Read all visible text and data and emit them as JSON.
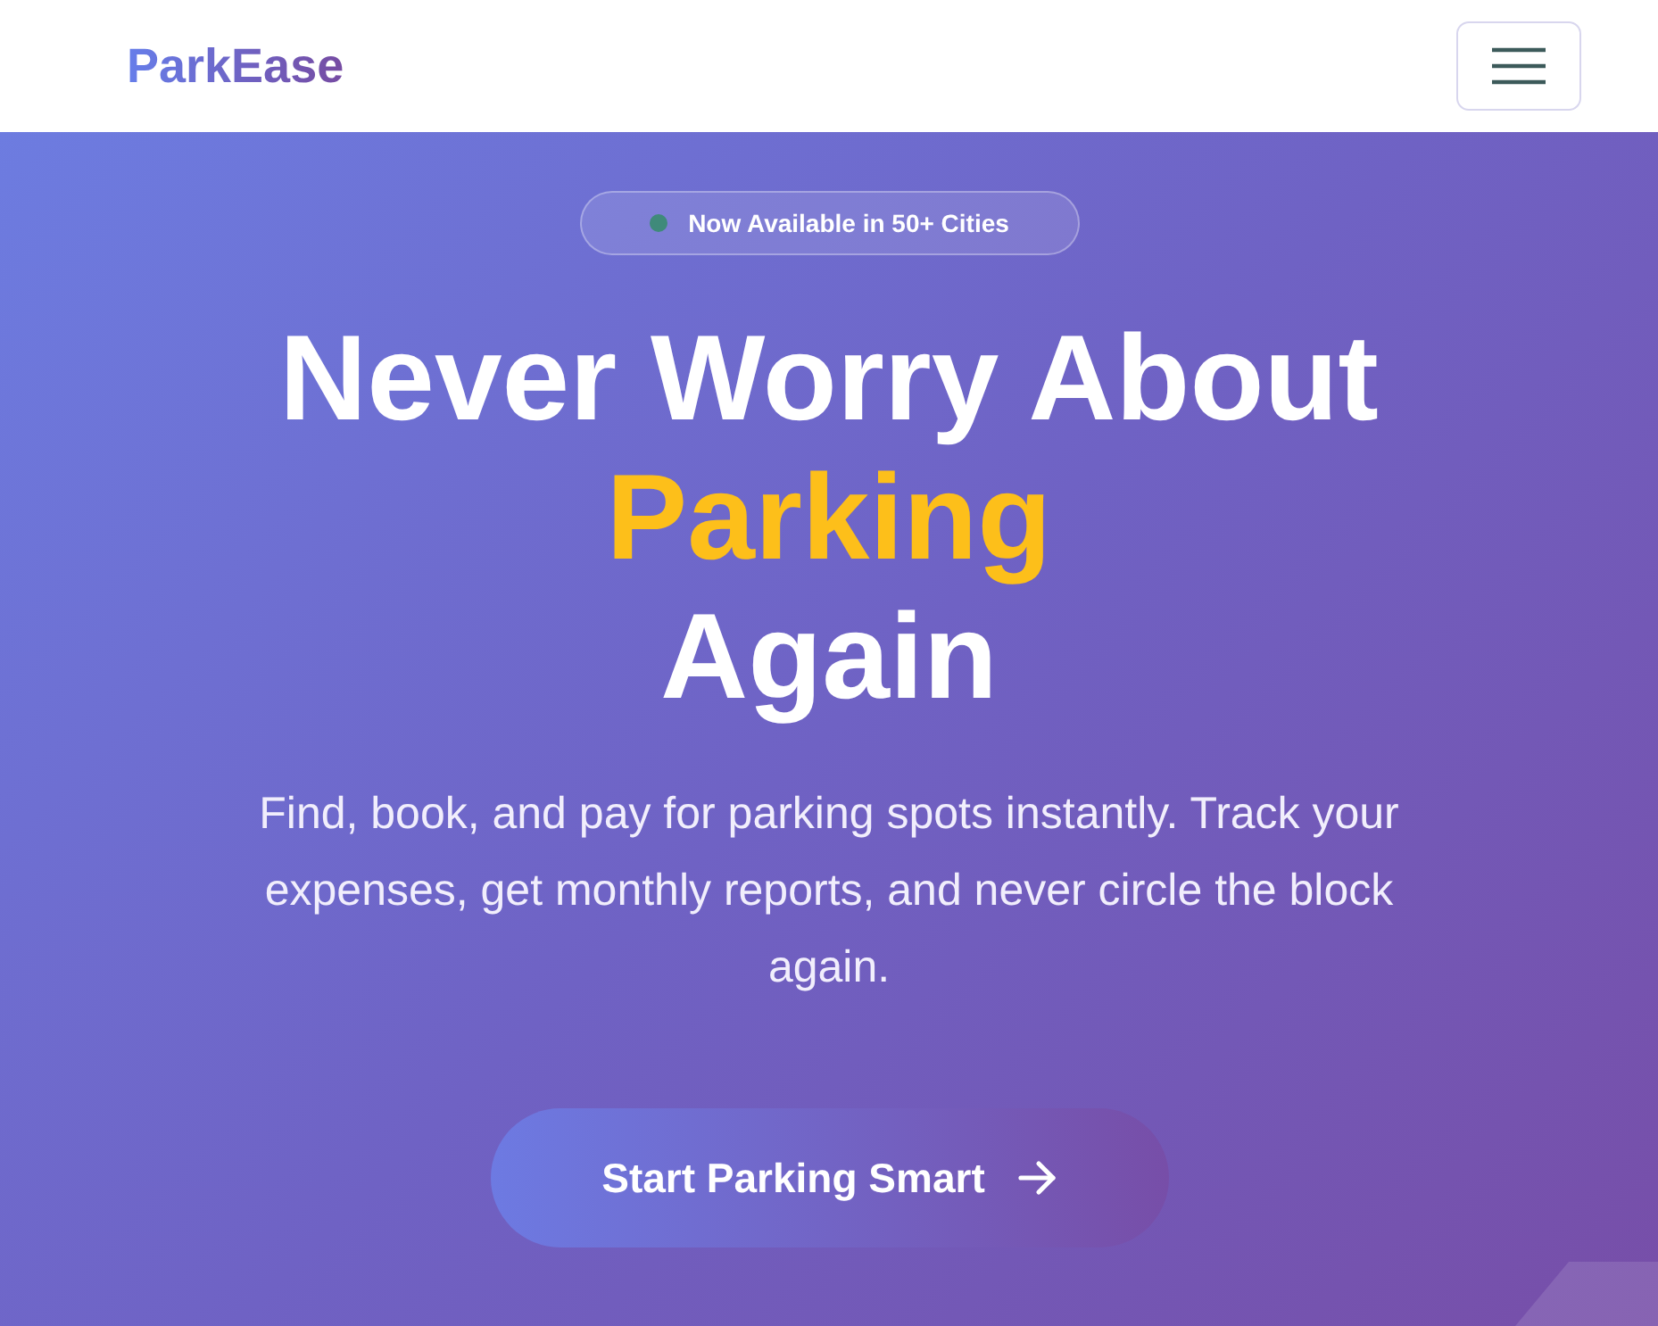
{
  "navbar": {
    "brand": "ParkEase"
  },
  "hero": {
    "badge": {
      "text": "Now Available in 50+ Cities"
    },
    "heading": {
      "before": "Never Worry About",
      "highlight": "Parking",
      "after": "Again"
    },
    "subtitle": "Find, book, and pay for parking spots instantly. Track your expenses, get monthly reports, and never circle the block again.",
    "cta": {
      "label": "Start Parking Smart"
    }
  }
}
